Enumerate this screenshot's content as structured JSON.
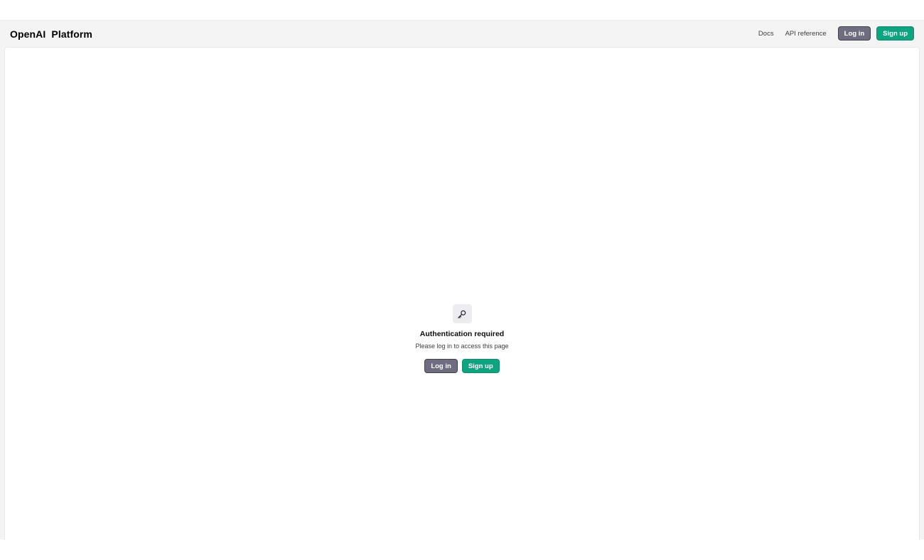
{
  "header": {
    "brand_company": "OpenAI",
    "brand_product": "Platform",
    "nav": {
      "docs": "Docs",
      "api_reference": "API reference",
      "log_in": "Log in",
      "sign_up": "Sign up"
    }
  },
  "auth": {
    "icon": "key-icon",
    "title": "Authentication required",
    "subtitle": "Please log in to access this page",
    "log_in": "Log in",
    "sign_up": "Sign up"
  },
  "colors": {
    "login_button": "#6e6e80",
    "signup_button": "#10a37f",
    "header_background": "#f4f4f4"
  }
}
